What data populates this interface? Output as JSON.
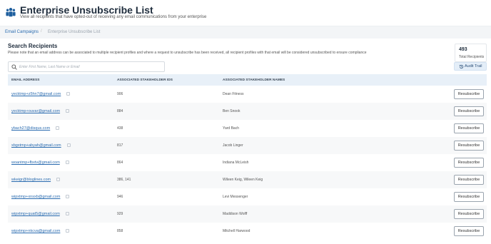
{
  "header": {
    "title": "Enterprise Unsubscribe List",
    "subtitle": "View all recipients that have opted-out of receiving any email communications from your enterprise"
  },
  "breadcrumb": {
    "items": [
      "Email Campaigns",
      "Enterprise Unsubscribe List"
    ],
    "separator": "/"
  },
  "search": {
    "title": "Search Recipients",
    "note": "Please note that an email address can be associated to multiple recipient profiles and where a request to unsubscribe has been received, all recipient profiles with that email will be considered unsubscribed to ensure compliance",
    "placeholder": "Enter First Name, Last Name or Email"
  },
  "stats": {
    "total": "493",
    "total_label": "Total Recipients"
  },
  "audit": {
    "label": "Audit Trail"
  },
  "table": {
    "columns": [
      "Email Address",
      "Associated Stakeholder IDs",
      "Associated Stakeholder Names"
    ],
    "action_label": "Resubscribe",
    "rows": [
      {
        "email": "yecktmp+z5hn7@gmail.com",
        "ids": "906",
        "names": "Dean Fitness"
      },
      {
        "email": "yecktmp+ouvar@gmail.com",
        "ids": "884",
        "names": "Ben Snook"
      },
      {
        "email": "ybach27@disqus.com",
        "ids": "438",
        "names": "Yard Bach"
      },
      {
        "email": "xbgxtmp+abyah@gmail.com",
        "ids": "817",
        "names": "Jacob Linger"
      },
      {
        "email": "woantmp+fbxtv@gmail.com",
        "ids": "864",
        "names": "Indiana McLeish"
      },
      {
        "email": "wkeigr@bloglines.com",
        "ids": "386, 141",
        "names": "Wileen Keig, Wileen Keig"
      },
      {
        "email": "wipxtmp+xnsxb@gmail.com",
        "ids": "946",
        "names": "Levi Messenger"
      },
      {
        "email": "wipxtmp+quat5@gmail.com",
        "ids": "929",
        "names": "Maddison Wolff"
      },
      {
        "email": "wipxtmp+nkcva@gmail.com",
        "ids": "858",
        "names": "Mitchell Harwood"
      }
    ]
  },
  "colors": {
    "accent": "#2b6cb0",
    "header_bg": "#e8f0f8",
    "audit_bg": "#e4eef8"
  },
  "icons": {
    "logo": "people-group-icon",
    "search": "search-icon",
    "audit": "history-icon",
    "copy": "copy-icon"
  }
}
